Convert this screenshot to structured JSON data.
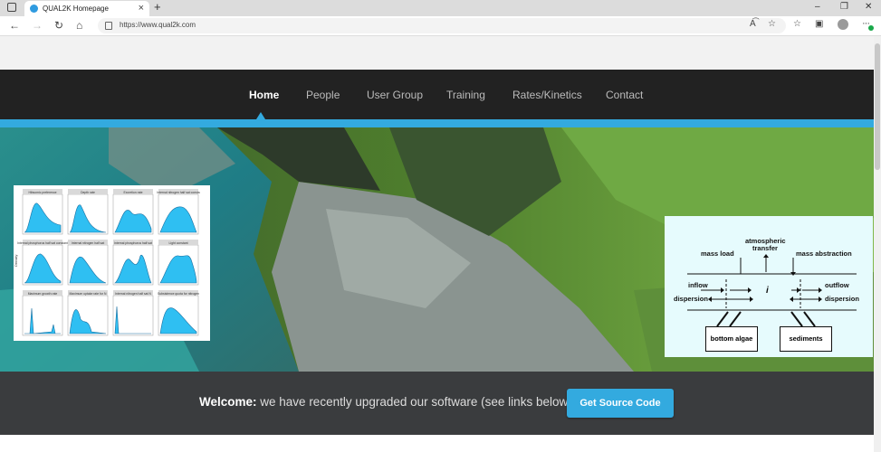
{
  "browser": {
    "tab_title": "QUAL2K Homepage",
    "tab_close": "×",
    "new_tab": "+",
    "url": "https://www.qual2k.com",
    "window_controls": [
      "–",
      "❐",
      "✕"
    ],
    "nav_icons": [
      "back-arrow-icon",
      "forward-arrow-icon",
      "reload-icon",
      "home-icon"
    ],
    "address_icons": [
      "read-aloud-icon",
      "favorite-star-icon",
      "favorites-icon",
      "collections-icon"
    ]
  },
  "site": {
    "nav": [
      {
        "label": "Home",
        "active": true
      },
      {
        "label": "People",
        "active": false
      },
      {
        "label": "User Group",
        "active": false
      },
      {
        "label": "Training",
        "active": false
      },
      {
        "label": "Rates/Kinetics",
        "active": false
      },
      {
        "label": "Contact",
        "active": false
      }
    ],
    "accent_color": "#33aadf",
    "navbar_color": "#222222",
    "welcome_bold": "Welcome:",
    "welcome_text": " we have recently upgraded our software (see links below)",
    "cta_label": "Get Source Code"
  },
  "diagram": {
    "atmospheric": "atmospheric",
    "transfer": "transfer",
    "mass_load": "mass load",
    "mass_abstraction": "mass abstraction",
    "inflow": "inflow",
    "dispersion_left": "dispersion",
    "center": "i",
    "outflow": "outflow",
    "dispersion_right": "dispersion",
    "bottom_algae": "bottom algae",
    "sediments": "sediments"
  },
  "density_panels": {
    "y_axis_label": "Density",
    "panel_titles": [
      "Hibsomic preference",
      "Depth rate",
      "Excretion rate",
      "Internal nitrogen half sat consta",
      "Internal phosphorus half sat constant",
      "Internal nitrogen half sat",
      "Internal phosphorus half sat",
      "Light constant",
      "Maximum growth rate",
      "Maximum uptake rate for N",
      "Internal nitrogen half sat N",
      "Subsistence quota for nitrogen"
    ]
  }
}
